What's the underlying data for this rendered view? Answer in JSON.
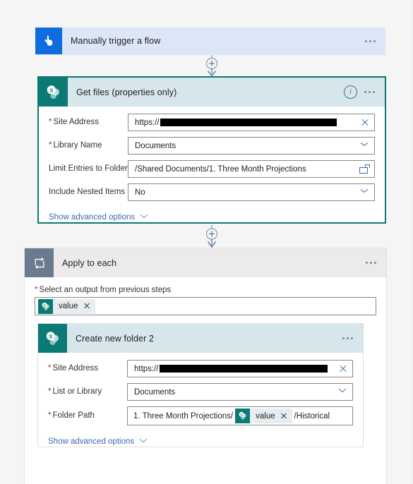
{
  "flow": {
    "trigger": {
      "icon": "tap-hand-icon",
      "title": "Manually trigger a flow",
      "icon_color": "#0f6cdf",
      "header_bg": "#dce6f7",
      "menu": "more-options"
    },
    "get_files": {
      "icon": "sharepoint-icon",
      "title": "Get files (properties only)",
      "icon_color": "#0b7a74",
      "header_bg": "#d6e6ea",
      "selected_border": "#0b7a74",
      "info_label": "i",
      "fields": [
        {
          "label": "Site Address",
          "required": true,
          "value": "https://",
          "redacted": true,
          "redact_width": 250,
          "control": "clear-x"
        },
        {
          "label": "Library Name",
          "required": true,
          "value": "Documents",
          "redacted": false,
          "control": "dropdown-chevron"
        },
        {
          "label": "Limit Entries to Folder",
          "required": false,
          "value": "/Shared Documents/1. Three Month Projections",
          "redacted": false,
          "control": "folder-picker"
        },
        {
          "label": "Include Nested Items",
          "required": false,
          "value": "No",
          "redacted": false,
          "control": "dropdown-chevron"
        }
      ],
      "advanced_label": "Show advanced options"
    },
    "apply_to_each": {
      "icon": "loop-repeat-icon",
      "title": "Apply to each",
      "icon_color": "#6b7a8f",
      "header_bg": "#eceaea",
      "select_output_label": "Select an output from previous steps",
      "select_output_required": true,
      "token": {
        "text": "value",
        "icon": "sharepoint-icon",
        "remove": "remove-token"
      }
    },
    "create_new_folder": {
      "icon": "sharepoint-icon",
      "title": "Create new folder 2",
      "icon_color": "#0b7a74",
      "header_bg": "#d6e6ea",
      "fields": [
        {
          "label": "Site Address",
          "required": true,
          "value": "https://",
          "redacted": true,
          "redact_width": 238,
          "control": "clear-x"
        },
        {
          "label": "List or Library",
          "required": true,
          "value": "Documents",
          "redacted": false,
          "control": "dropdown-chevron"
        }
      ],
      "folder_path": {
        "label": "Folder Path",
        "required": true,
        "prefix": "1. Three Month Projections/",
        "token": {
          "text": "value",
          "icon": "sharepoint-icon",
          "remove": "remove-token"
        },
        "suffix": "/Historical"
      },
      "advanced_label": "Show advanced options"
    },
    "connectors": [
      {
        "name": "connector-trigger-to-getfiles",
        "add_label": "+"
      },
      {
        "name": "connector-getfiles-to-apply",
        "add_label": "+"
      }
    ]
  },
  "colors": {
    "page_bg": "#f5f5f5",
    "sharepoint_teal": "#0b7a74",
    "trigger_blue": "#0f6cdf",
    "loop_gray": "#6b7a8f",
    "link_blue": "#3b6cb4",
    "required_red": "#a4262c"
  }
}
